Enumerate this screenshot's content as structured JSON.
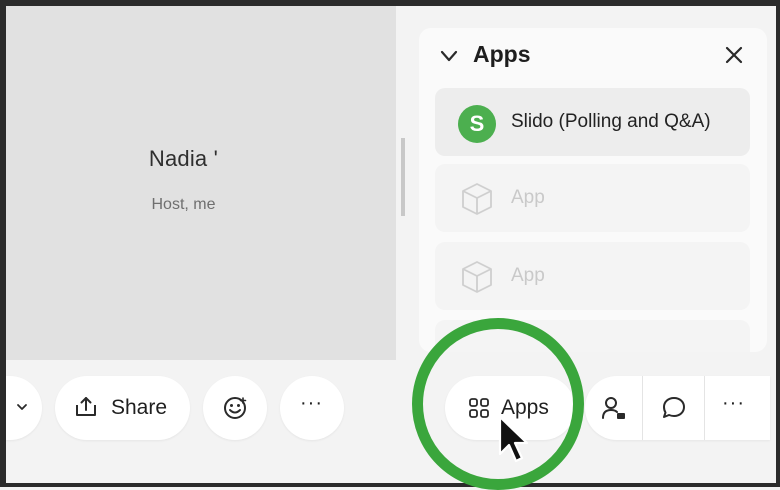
{
  "video": {
    "participant_name": "Nadia '",
    "participant_role": "Host, me"
  },
  "apps_panel": {
    "title": "Apps",
    "items": [
      {
        "icon_letter": "S",
        "label": "Slido (Polling and Q&A)",
        "icon": "slido-icon"
      },
      {
        "label": "App",
        "icon": "cube-icon"
      },
      {
        "label": "App",
        "icon": "cube-icon"
      }
    ]
  },
  "toolbar": {
    "share_label": "Share",
    "more_label": "···",
    "apps_label": "Apps",
    "right_more_label": "···"
  },
  "colors": {
    "accent_green": "#3aa63c",
    "slido_green": "#4caf4f"
  }
}
